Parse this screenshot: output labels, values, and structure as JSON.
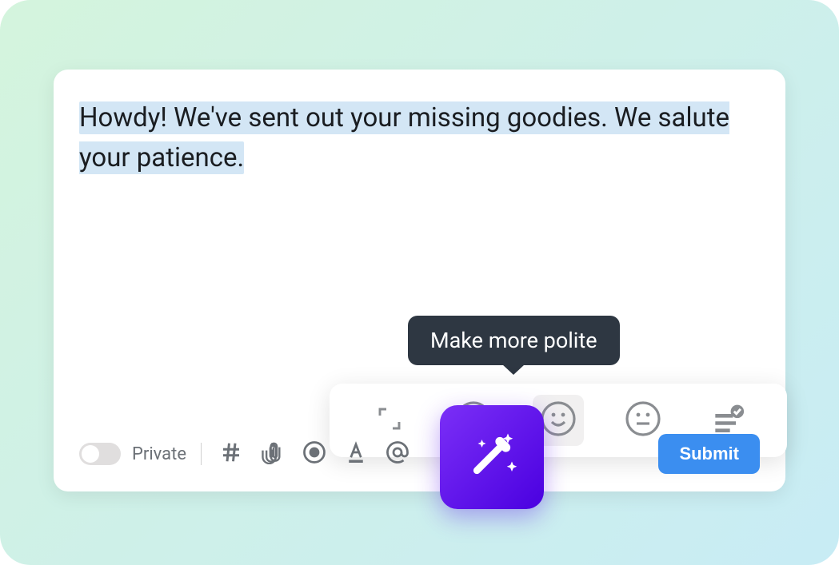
{
  "message": {
    "text": "Howdy! We've sent out your missing goodies. We salute your patience."
  },
  "tooltip": {
    "label": "Make more polite"
  },
  "bottom_toolbar": {
    "private_label": "Private",
    "submit_label": "Submit"
  },
  "tone_options": {
    "expand": "expand",
    "happy": "make-friendlier",
    "polite": "make-polite",
    "neutral": "make-neutral",
    "summarize": "summarize"
  }
}
